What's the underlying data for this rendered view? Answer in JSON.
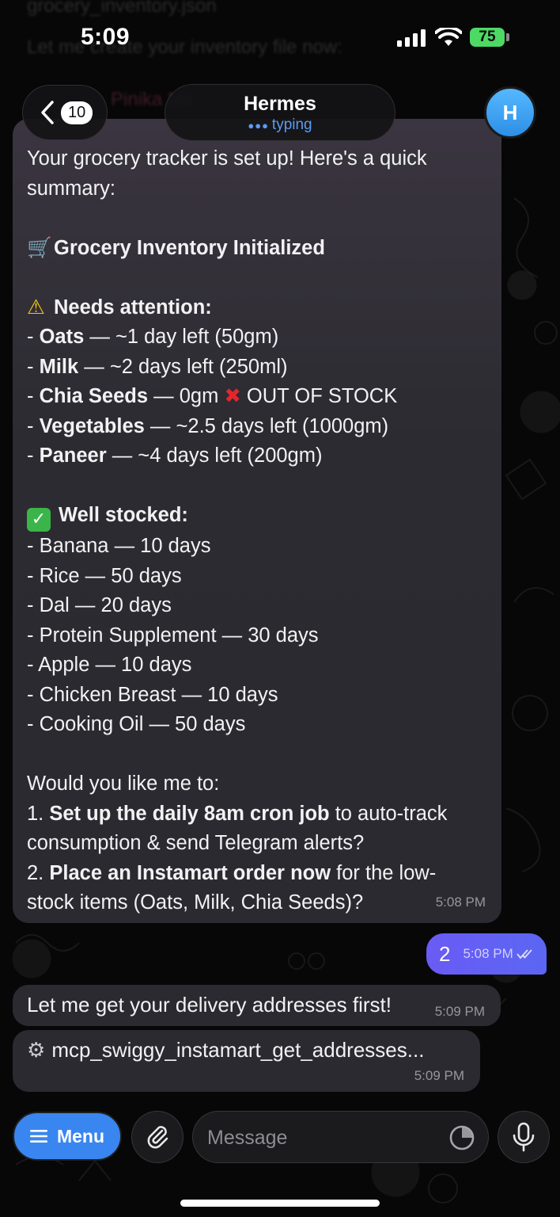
{
  "status_bar": {
    "time": "5:09",
    "battery": "75"
  },
  "ghost": {
    "line1": "grocery_inventory.json",
    "line2": "Let me create your inventory file now:",
    "line3": "Pinika Mit"
  },
  "header": {
    "back_count": "10",
    "chat_name": "Hermes",
    "chat_status": "typing",
    "avatar_letter": "H"
  },
  "messages": {
    "summary": {
      "intro_1": "Your grocery tracker is set up! Here's a quick",
      "intro_2": "summary:",
      "heading": "Grocery Inventory Initialized",
      "heading_emoji": "🛒",
      "attention_title": "Needs attention:",
      "attention_items": [
        {
          "prefix": "- ",
          "name": "Oats",
          "detail": " — ~1 day left (50gm)"
        },
        {
          "prefix": "- ",
          "name": "Milk",
          "detail": " — ~2 days left (250ml)"
        },
        {
          "prefix": "- ",
          "name": "Chia Seeds",
          "detail": " — 0gm ",
          "flag": "OUT OF STOCK"
        },
        {
          "prefix": "- ",
          "name": "Vegetables",
          "detail": " — ~2.5 days left (1000gm)"
        },
        {
          "prefix": "- ",
          "name": "Paneer",
          "detail": " — ~4 days left (200gm)"
        }
      ],
      "stocked_title": "Well stocked:",
      "stocked_items": [
        "- Banana — 10 days",
        "- Rice — 50 days",
        "- Dal — 20 days",
        "- Protein Supplement — 30 days",
        "- Apple — 10 days",
        "- Chicken Breast — 10 days",
        "- Cooking Oil — 50 days"
      ],
      "question": "Would you like me to:",
      "option1_num": "1. ",
      "option1_bold": "Set up the daily 8am cron job",
      "option1_rest": " to auto-track",
      "option1_line2": "consumption & send Telegram alerts?",
      "option2_num": "2. ",
      "option2_bold": "Place an Instamart order now",
      "option2_rest": " for the low-",
      "option2_line2": "stock items (Oats, Milk, Chia Seeds)?",
      "time": "5:08 PM"
    },
    "reply": {
      "text": "2",
      "time": "5:08 PM"
    },
    "address": {
      "text": "Let me get your delivery addresses first!",
      "time": "5:09 PM"
    },
    "tool": {
      "text": "mcp_swiggy_instamart_get_addresses...",
      "time": "5:09 PM"
    }
  },
  "input_bar": {
    "menu_label": "Menu",
    "message_placeholder": "Message"
  },
  "icons": {
    "back": "chevron-left-icon",
    "attach": "paperclip-icon",
    "sticker": "sticker-icon",
    "mic": "microphone-icon",
    "menu": "hamburger-icon"
  },
  "colors": {
    "accent_blue": "#3a86f0",
    "outgoing_bubble": "#6a5bf5",
    "incoming_bubble": "#2b2a31",
    "typing_status": "#5b9bf0",
    "battery": "#4cd964"
  }
}
